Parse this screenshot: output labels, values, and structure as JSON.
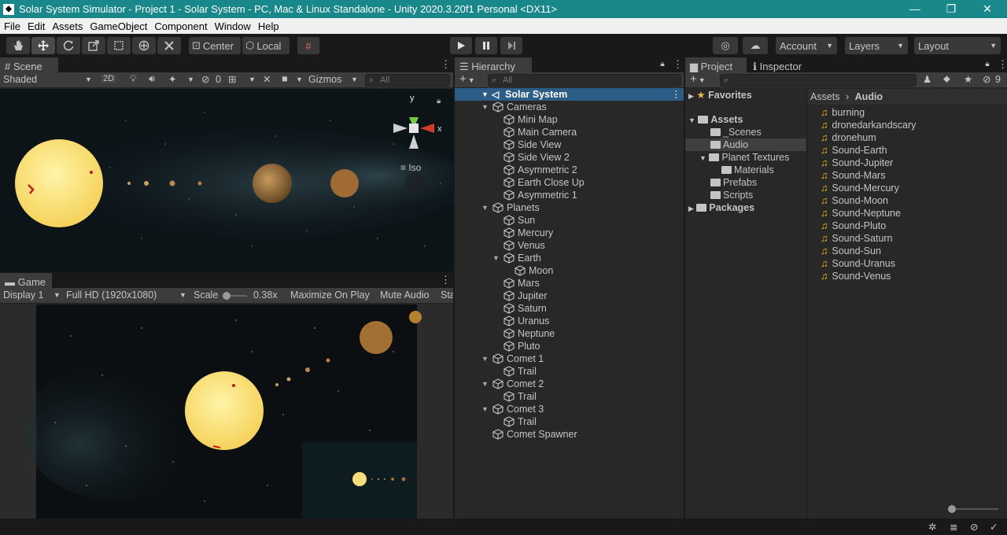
{
  "window": {
    "title": "Solar System Simulator - Project 1 - Solar System - PC, Mac & Linux Standalone - Unity 2020.3.20f1 Personal <DX11>"
  },
  "menu": [
    "File",
    "Edit",
    "Assets",
    "GameObject",
    "Component",
    "Window",
    "Help"
  ],
  "toolbar": {
    "pivot": "Center",
    "space": "Local",
    "account": "Account",
    "layers": "Layers",
    "layout": "Layout"
  },
  "scene": {
    "tab": "Scene",
    "shading": "Shaded",
    "mode2d": "2D",
    "hidden_count": "0",
    "gizmos": "Gizmos",
    "search_placeholder": "All",
    "gizmo_x": "x",
    "gizmo_y": "y",
    "projection": "Iso"
  },
  "game": {
    "tab": "Game",
    "display": "Display 1",
    "resolution": "Full HD (1920x1080)",
    "scale_label": "Scale",
    "scale_value": "0.38x",
    "maximize": "Maximize On Play",
    "mute": "Mute Audio",
    "stats": "Sta"
  },
  "hierarchy": {
    "tab": "Hierarchy",
    "search_placeholder": "All",
    "scene_name": "Solar System",
    "items": [
      {
        "label": "Cameras"
      },
      {
        "label": "Mini Map"
      },
      {
        "label": "Main Camera"
      },
      {
        "label": "Side View"
      },
      {
        "label": "Side View 2"
      },
      {
        "label": "Asymmetric 2"
      },
      {
        "label": "Earth Close Up"
      },
      {
        "label": "Asymmetric 1"
      },
      {
        "label": "Planets"
      },
      {
        "label": "Sun"
      },
      {
        "label": "Mercury"
      },
      {
        "label": "Venus"
      },
      {
        "label": "Earth"
      },
      {
        "label": "Moon"
      },
      {
        "label": "Mars"
      },
      {
        "label": "Jupiter"
      },
      {
        "label": "Saturn"
      },
      {
        "label": "Uranus"
      },
      {
        "label": "Neptune"
      },
      {
        "label": "Pluto"
      },
      {
        "label": "Comet 1"
      },
      {
        "label": "Trail"
      },
      {
        "label": "Comet 2"
      },
      {
        "label": "Trail"
      },
      {
        "label": "Comet 3"
      },
      {
        "label": "Trail"
      },
      {
        "label": "Comet Spawner"
      }
    ]
  },
  "project": {
    "tab": "Project",
    "inspector_tab": "Inspector",
    "hidden_count": "9",
    "tree": {
      "favorites": "Favorites",
      "assets": "Assets",
      "scenes": "_Scenes",
      "audio": "Audio",
      "planet_textures": "Planet Textures",
      "materials": "Materials",
      "prefabs": "Prefabs",
      "scripts": "Scripts",
      "packages": "Packages"
    },
    "breadcrumb": [
      "Assets",
      "Audio"
    ],
    "files": [
      "burning",
      "dronedarkandscary",
      "dronehum",
      "Sound-Earth",
      "Sound-Jupiter",
      "Sound-Mars",
      "Sound-Mercury",
      "Sound-Moon",
      "Sound-Neptune",
      "Sound-Pluto",
      "Sound-Saturn",
      "Sound-Sun",
      "Sound-Uranus",
      "Sound-Venus"
    ]
  },
  "colors": {
    "titlebar": "#19888a",
    "selection": "#2c5d87",
    "editor_bg": "#282828",
    "audio_icon": "#f5b800"
  }
}
